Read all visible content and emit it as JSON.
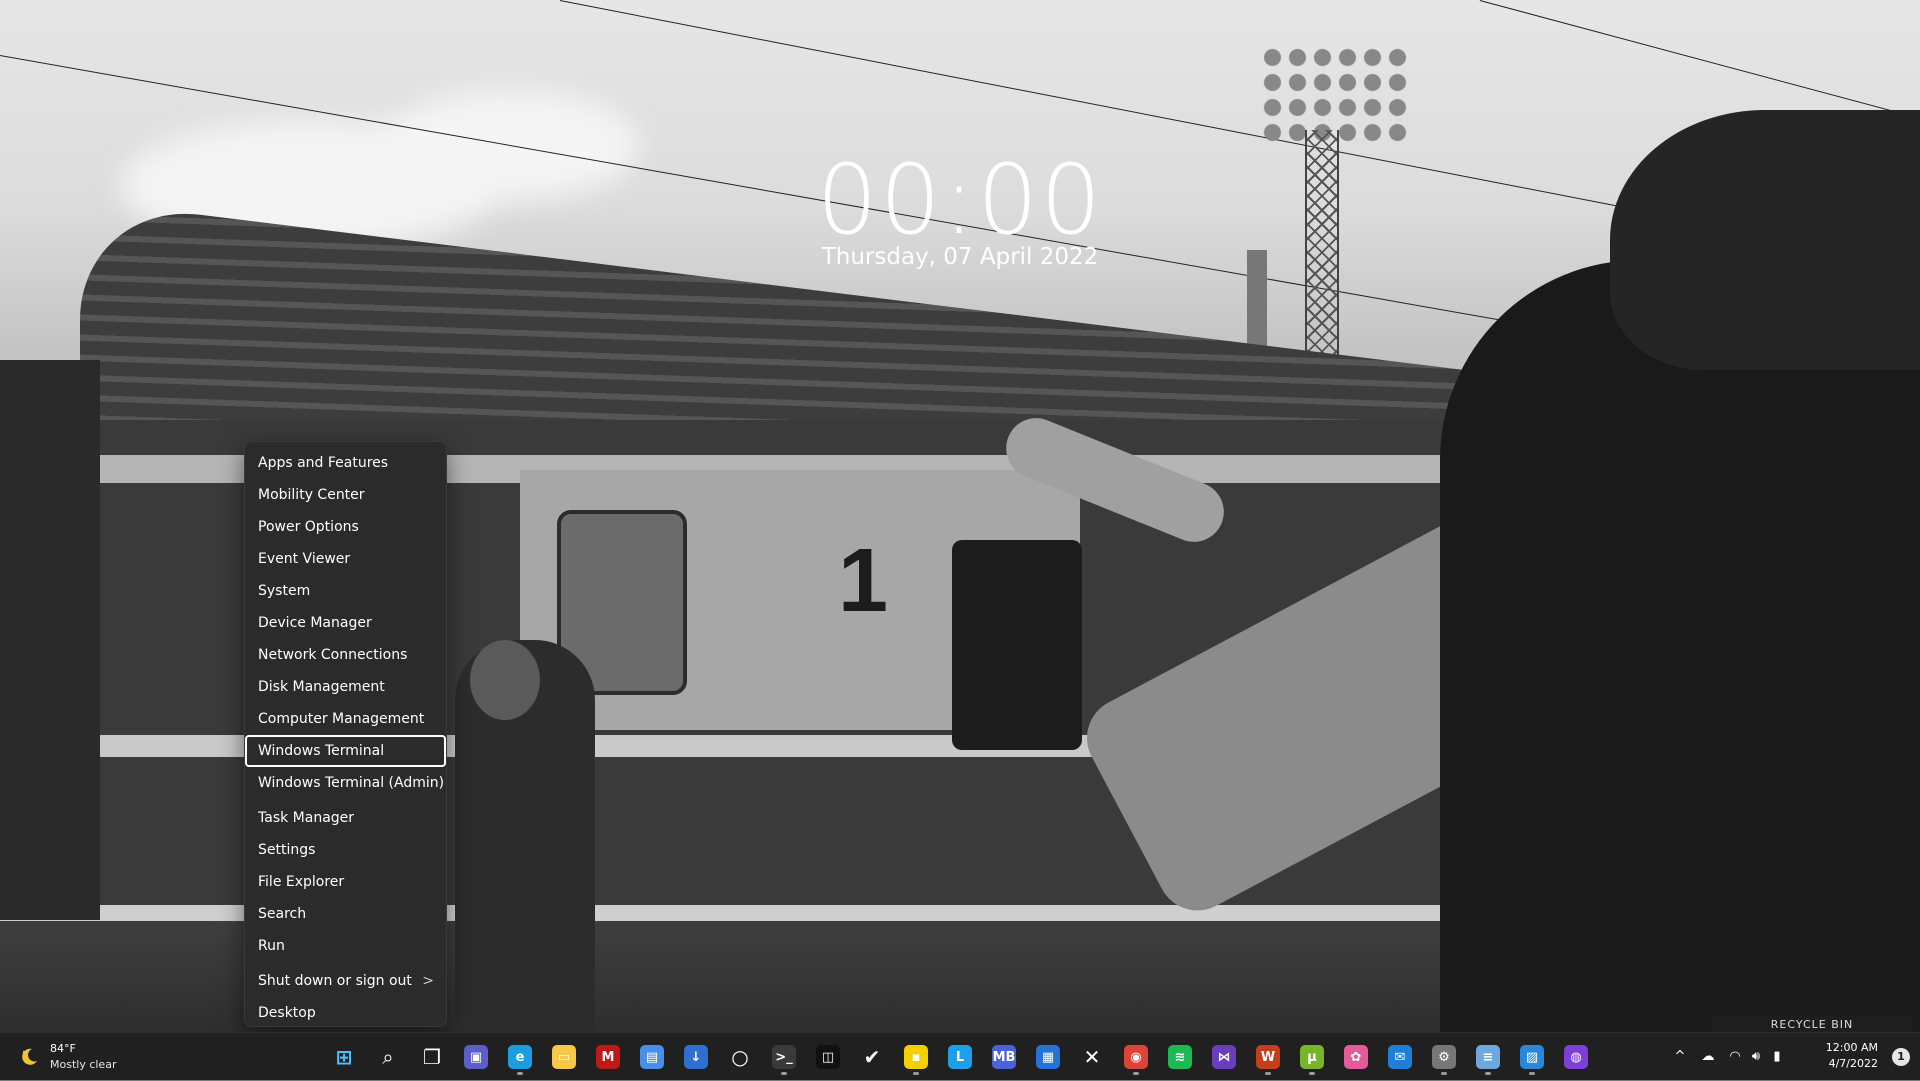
{
  "lockclock": {
    "time": "00:00",
    "date": "Thursday, 07 April 2022"
  },
  "winx_menu": {
    "items": [
      {
        "label": "Apps and Features"
      },
      {
        "label": "Mobility Center"
      },
      {
        "label": "Power Options"
      },
      {
        "label": "Event Viewer"
      },
      {
        "label": "System"
      },
      {
        "label": "Device Manager"
      },
      {
        "label": "Network Connections"
      },
      {
        "label": "Disk Management"
      },
      {
        "label": "Computer Management"
      },
      {
        "label": "Windows Terminal",
        "focused": true
      },
      {
        "label": "Windows Terminal (Admin)"
      },
      {
        "label": "Task Manager"
      },
      {
        "label": "Settings"
      },
      {
        "label": "File Explorer"
      },
      {
        "label": "Search"
      },
      {
        "label": "Run"
      },
      {
        "label": "Shut down or sign out",
        "submenu": true
      },
      {
        "label": "Desktop"
      }
    ],
    "submenu_chevron": ">"
  },
  "desktop": {
    "recycle_bin_label": "RECYCLE BIN"
  },
  "taskbar": {
    "weather": {
      "temp": "84°F",
      "condition": "Mostly clear",
      "icon": "moon-weather-icon"
    },
    "apps": [
      {
        "name": "start-button",
        "icon": "windows-logo-icon",
        "color": "#4cc2ff",
        "glyph": "⊞"
      },
      {
        "name": "search-button",
        "icon": "search-icon",
        "color": "transparent",
        "glyph": "⌕"
      },
      {
        "name": "task-view-button",
        "icon": "task-view-icon",
        "color": "transparent",
        "glyph": "❐"
      },
      {
        "name": "teams-chat-button",
        "icon": "teams-chat-icon",
        "color": "#5b5fc7",
        "glyph": "▣"
      },
      {
        "name": "edge-button",
        "icon": "edge-icon",
        "color": "#1b9de2",
        "glyph": "e",
        "running": true
      },
      {
        "name": "file-explorer-button",
        "icon": "folder-icon",
        "color": "#f7c948",
        "glyph": "▭"
      },
      {
        "name": "mcafee-button",
        "icon": "mcafee-icon",
        "color": "#c01818",
        "glyph": "M"
      },
      {
        "name": "store-button",
        "icon": "store-icon",
        "color": "#4a8fe7",
        "glyph": "▤"
      },
      {
        "name": "app-installer-button",
        "icon": "app-installer-icon",
        "color": "#2f6fcf",
        "glyph": "↓"
      },
      {
        "name": "cortana-button",
        "icon": "cortana-icon",
        "color": "transparent",
        "glyph": "○"
      },
      {
        "name": "terminal-button",
        "icon": "terminal-icon",
        "color": "#3a3a3a",
        "glyph": ">_",
        "running": true
      },
      {
        "name": "roblox-button",
        "icon": "roblox-icon",
        "color": "#111111",
        "glyph": "◫"
      },
      {
        "name": "todo-button",
        "icon": "checkmark-icon",
        "color": "transparent",
        "glyph": "✔"
      },
      {
        "name": "sticky-notes-button",
        "icon": "sticky-notes-icon",
        "color": "#f5d000",
        "glyph": "▪",
        "running": true
      },
      {
        "name": "l-app-button",
        "icon": "l-letter-icon",
        "color": "#1ea0e8",
        "glyph": "L"
      },
      {
        "name": "mb-app-button",
        "icon": "mb-icon",
        "color": "#4b63d8",
        "glyph": "MB"
      },
      {
        "name": "calendar-button",
        "icon": "calendar-icon",
        "color": "#2673d8",
        "glyph": "▦"
      },
      {
        "name": "xbox-button",
        "icon": "xbox-x-icon",
        "color": "transparent",
        "glyph": "✕"
      },
      {
        "name": "chrome-button",
        "icon": "chrome-icon",
        "color": "#db4437",
        "glyph": "◉",
        "running": true
      },
      {
        "name": "spotify-button",
        "icon": "spotify-icon",
        "color": "#1db954",
        "glyph": "≋"
      },
      {
        "name": "visual-studio-button",
        "icon": "visual-studio-icon",
        "color": "#6a3dbd",
        "glyph": "⋈"
      },
      {
        "name": "office-button",
        "icon": "office-w-icon",
        "color": "#c43e1c",
        "glyph": "W",
        "running": true
      },
      {
        "name": "utorrent-button",
        "icon": "utorrent-icon",
        "color": "#78b52b",
        "glyph": "µ",
        "running": true
      },
      {
        "name": "paint-button",
        "icon": "paint-palette-icon",
        "color": "#e55a9a",
        "glyph": "✿"
      },
      {
        "name": "mail-button",
        "icon": "mail-icon",
        "color": "#1f7fd8",
        "glyph": "✉"
      },
      {
        "name": "settings-button",
        "icon": "gear-icon",
        "color": "#777777",
        "glyph": "⚙",
        "running": true
      },
      {
        "name": "notepad-button",
        "icon": "notepad-icon",
        "color": "#6fa8dc",
        "glyph": "≡",
        "running": true
      },
      {
        "name": "photos-button",
        "icon": "photos-icon",
        "color": "#2b88d8",
        "glyph": "▨",
        "running": true
      },
      {
        "name": "github-button",
        "icon": "github-icon",
        "color": "#7c3fd8",
        "glyph": "◍"
      }
    ],
    "tray": {
      "chevron": "^",
      "time": "12:00 AM",
      "date": "4/7/2022",
      "notification_count": "1"
    }
  }
}
